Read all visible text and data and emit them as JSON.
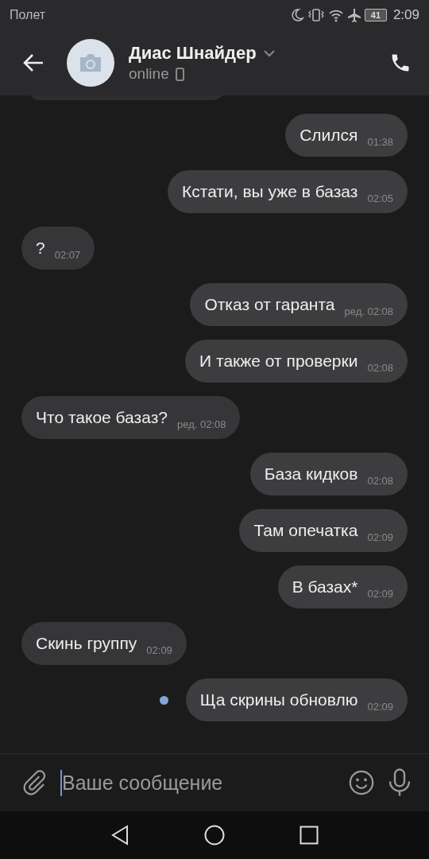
{
  "status_bar": {
    "carrier": "Полет",
    "battery": "41",
    "time": "2:09"
  },
  "header": {
    "name": "Диас Шнайдер",
    "presence": "online"
  },
  "messages": [
    {
      "text": "Слился",
      "time": "01:38",
      "outgoing": true,
      "unread": false
    },
    {
      "text": "Кстати, вы уже в базаз",
      "time": "02:05",
      "outgoing": true,
      "unread": false
    },
    {
      "text": "?",
      "time": "02:07",
      "outgoing": false,
      "unread": false
    },
    {
      "text": "Отказ от гаранта",
      "time": "ред. 02:08",
      "outgoing": true,
      "unread": false
    },
    {
      "text": "И также от проверки",
      "time": "02:08",
      "outgoing": true,
      "unread": false
    },
    {
      "text": "Что такое базаз?",
      "time": "ред. 02:08",
      "outgoing": false,
      "unread": false
    },
    {
      "text": "База кидков",
      "time": "02:08",
      "outgoing": true,
      "unread": false
    },
    {
      "text": "Там опечатка",
      "time": "02:09",
      "outgoing": true,
      "unread": false
    },
    {
      "text": "В базах*",
      "time": "02:09",
      "outgoing": true,
      "unread": false
    },
    {
      "text": "Скинь группу",
      "time": "02:09",
      "outgoing": false,
      "unread": false
    },
    {
      "text": "Ща скрины обновлю",
      "time": "02:09",
      "outgoing": true,
      "unread": true
    }
  ],
  "composer": {
    "placeholder": "Ваше сообщение"
  }
}
